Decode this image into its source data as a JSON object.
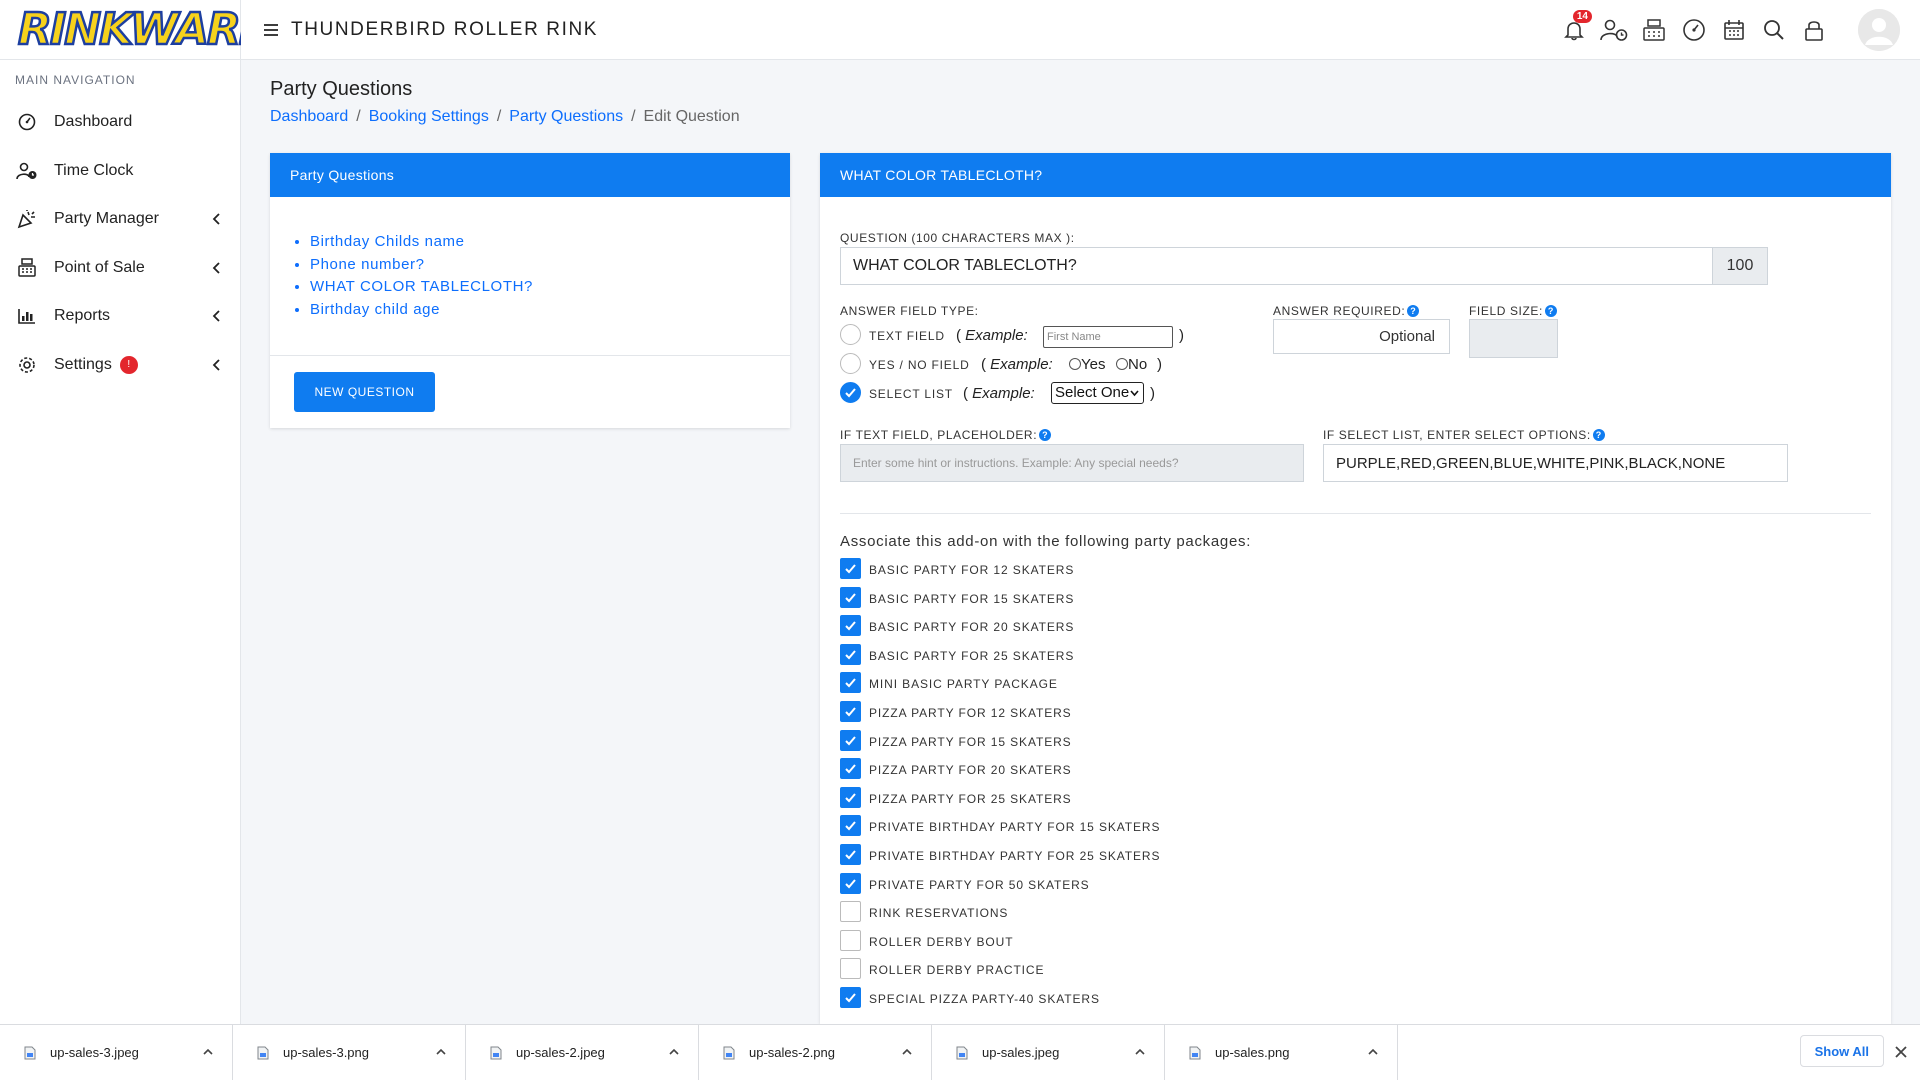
{
  "brand": {
    "logo_text": "RINKWARE"
  },
  "topbar": {
    "title": "THUNDERBIRD ROLLER RINK",
    "notifications": "14"
  },
  "sidebar": {
    "header": "MAIN NAVIGATION",
    "items": [
      {
        "label": "Dashboard"
      },
      {
        "label": "Time Clock"
      },
      {
        "label": "Party Manager"
      },
      {
        "label": "Point of Sale"
      },
      {
        "label": "Reports"
      },
      {
        "label": "Settings",
        "badge": "!"
      }
    ]
  },
  "page": {
    "title": "Party Questions",
    "breadcrumb": [
      "Dashboard",
      "Booking Settings",
      "Party Questions",
      "Edit Question"
    ]
  },
  "left_card": {
    "title": "Party Questions",
    "questions": [
      "Birthday Childs name",
      "Phone number?",
      "WHAT COLOR TABLECLOTH?",
      "Birthday child age"
    ],
    "new_button": "NEW QUESTION"
  },
  "right_card": {
    "title": "WHAT COLOR TABLECLOTH?",
    "question_label": "QUESTION (100 CHARACTERS MAX ):",
    "question_value": "WHAT COLOR TABLECLOTH?",
    "char_count": "100",
    "answer_type_label": "ANSWER FIELD TYPE:",
    "types": {
      "text": "TEXT FIELD",
      "yesno": "YES / NO FIELD",
      "select": "SELECT LIST"
    },
    "example_label": "Example:",
    "open_paren": "(",
    "close_paren": ")",
    "example_text_placeholder": "First Name",
    "example_yes": "Yes",
    "example_no": "No",
    "example_select": "Select One",
    "answer_required_label": "ANSWER REQUIRED:",
    "answer_required_value": "Optional",
    "field_size_label": "FIELD SIZE:",
    "placeholder_label": "IF TEXT FIELD, PLACEHOLDER:",
    "placeholder_hint": "Enter some hint or instructions. Example: Any special needs?",
    "options_label": "IF SELECT LIST, ENTER SELECT OPTIONS:",
    "options_value": "PURPLE,RED,GREEN,BLUE,WHITE,PINK,BLACK,NONE",
    "associate_label": "Associate this add-on with the following party packages:",
    "packages": [
      {
        "name": "BASIC PARTY FOR 12 SKATERS",
        "checked": true
      },
      {
        "name": "BASIC PARTY FOR 15 SKATERS",
        "checked": true
      },
      {
        "name": "BASIC PARTY FOR 20 SKATERS",
        "checked": true
      },
      {
        "name": "BASIC PARTY FOR 25 SKATERS",
        "checked": true
      },
      {
        "name": "MINI BASIC PARTY PACKAGE",
        "checked": true
      },
      {
        "name": "PIZZA PARTY FOR 12 SKATERS",
        "checked": true
      },
      {
        "name": "PIZZA PARTY FOR 15 SKATERS",
        "checked": true
      },
      {
        "name": "PIZZA PARTY FOR 20 SKATERS",
        "checked": true
      },
      {
        "name": "PIZZA PARTY FOR 25 SKATERS",
        "checked": true
      },
      {
        "name": "PRIVATE BIRTHDAY PARTY FOR 15 SKATERS",
        "checked": true
      },
      {
        "name": "PRIVATE BIRTHDAY PARTY FOR 25 SKATERS",
        "checked": true
      },
      {
        "name": "PRIVATE PARTY FOR 50 SKATERS",
        "checked": true
      },
      {
        "name": "RINK RESERVATIONS",
        "checked": false
      },
      {
        "name": "ROLLER DERBY BOUT",
        "checked": false
      },
      {
        "name": "ROLLER DERBY PRACTICE",
        "checked": false
      },
      {
        "name": "SPECIAL PIZZA PARTY-40 SKATERS",
        "checked": true
      }
    ]
  },
  "downloads": {
    "files": [
      "up-sales-3.jpeg",
      "up-sales-3.png",
      "up-sales-2.jpeg",
      "up-sales-2.png",
      "up-sales.jpeg",
      "up-sales.png"
    ],
    "show_all": "Show All"
  },
  "colors": {
    "primary": "#0f7cf0",
    "badge": "#e3262d",
    "background": "#f4f6f9"
  }
}
